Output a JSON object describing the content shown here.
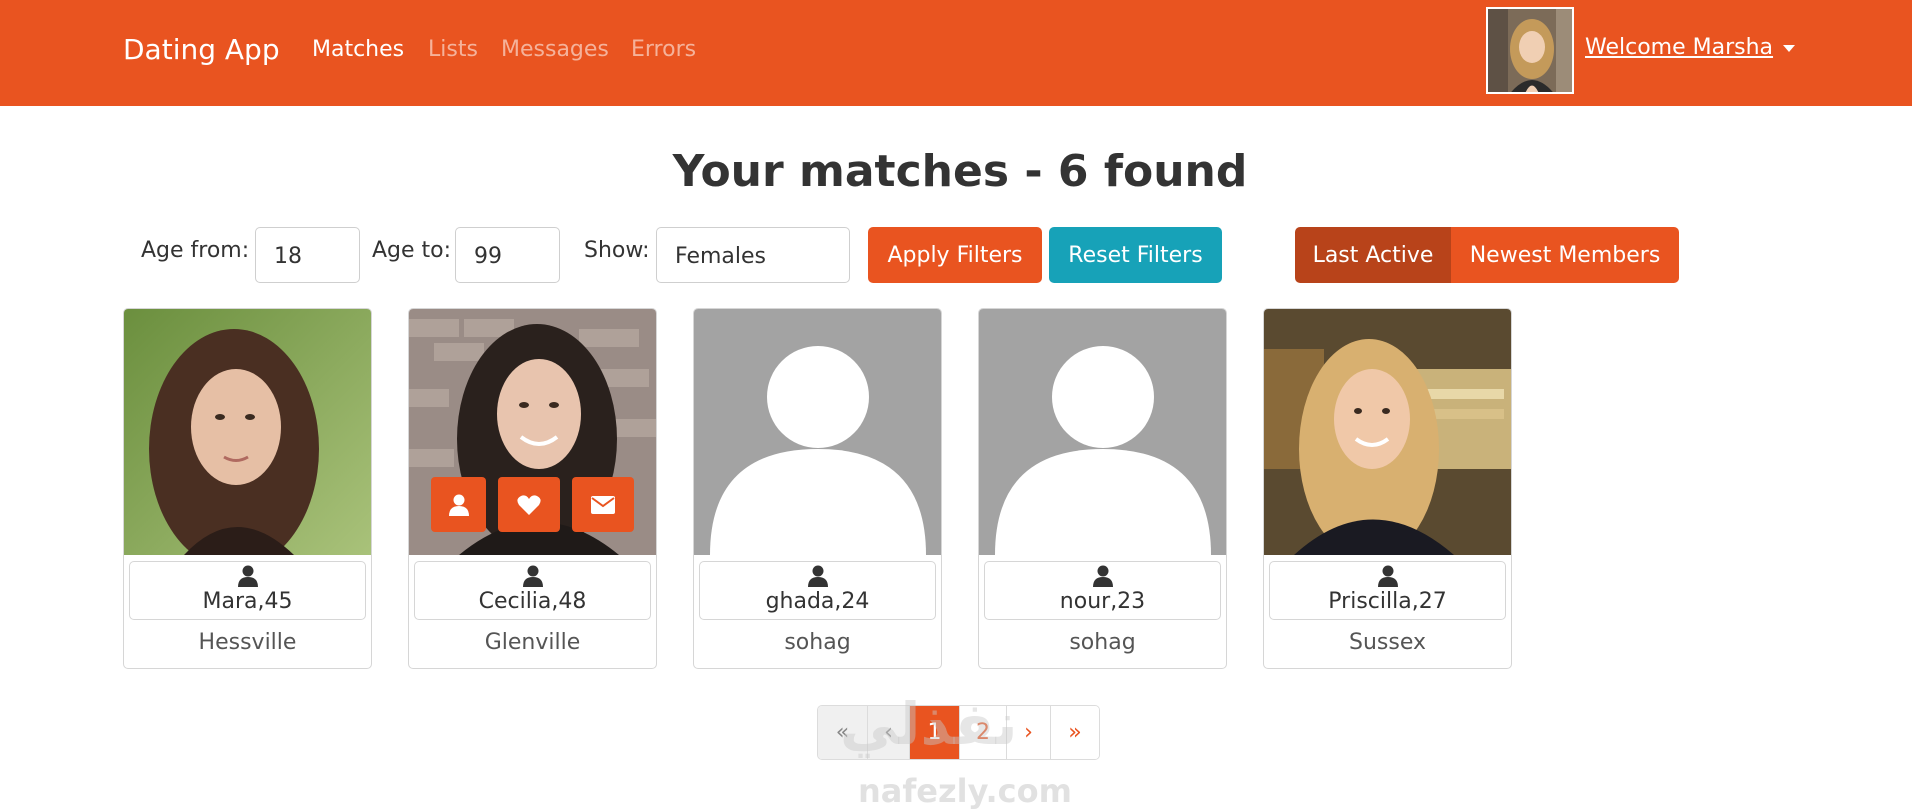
{
  "navbar": {
    "brand": "Dating App",
    "links": [
      "Matches",
      "Lists",
      "Messages",
      "Errors"
    ],
    "welcome": "Welcome Marsha",
    "color": "#e95420"
  },
  "page_title": "Your matches - 6 found",
  "filters": {
    "age_from_label": "Age from:",
    "age_from_value": "18",
    "age_to_label": "Age to:",
    "age_to_value": "99",
    "show_label": "Show:",
    "show_value": "Females",
    "apply_label": "Apply Filters",
    "reset_label": "Reset Filters"
  },
  "sort": {
    "last_active": "Last Active",
    "newest_members": "Newest Members"
  },
  "members": [
    {
      "name": "Mara,45",
      "city": "Hessville",
      "photo": "photo-woman-brown-hair"
    },
    {
      "name": "Cecilia,48",
      "city": "Glenville",
      "photo": "photo-woman-dark-hair"
    },
    {
      "name": "ghada,24",
      "city": "sohag",
      "photo": "default-user-silhouette"
    },
    {
      "name": "nour,23",
      "city": "sohag",
      "photo": "default-user-silhouette"
    },
    {
      "name": "Priscilla,27",
      "city": "Sussex",
      "photo": "photo-woman-blonde-hair"
    }
  ],
  "card_actions": [
    "user-icon",
    "heart-icon",
    "envelope-icon"
  ],
  "pagination": {
    "first": "«",
    "prev": "‹",
    "pages": [
      "1",
      "2"
    ],
    "active_page": "1",
    "next": "›",
    "last": "»"
  },
  "watermark": {
    "arabic": "نفذلي",
    "latin": "nafezly.com"
  }
}
